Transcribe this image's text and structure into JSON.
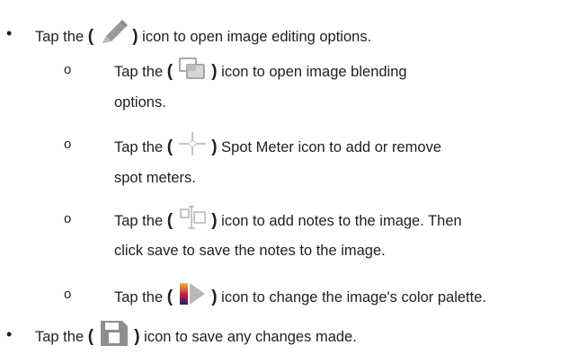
{
  "bullets": {
    "main_symbol": "•",
    "sub_symbol": "o"
  },
  "items": {
    "edit": {
      "prefix": "Tap the",
      "open_paren": "(",
      "close_paren": ")",
      "icon": "pencil-edit-icon",
      "suffix": "icon to open image editing options."
    },
    "blend": {
      "prefix": "Tap the",
      "open_paren": "(",
      "close_paren": ")",
      "icon": "image-blend-icon",
      "suffix": "icon to open image blending",
      "continuation": "options."
    },
    "spot": {
      "prefix": "Tap the",
      "open_paren": "(",
      "close_paren": ")",
      "icon": "spot-meter-crosshair-icon",
      "suffix": "Spot Meter icon to add or remove",
      "continuation": "spot meters."
    },
    "notes": {
      "prefix": "Tap the",
      "open_paren": "(",
      "close_paren": ")",
      "icon": "notes-annotation-icon",
      "suffix": "icon to add notes to the image. Then",
      "continuation": "click save to save the notes to the image."
    },
    "palette": {
      "prefix": "Tap the",
      "open_paren": "(",
      "close_paren": ")",
      "icon": "color-palette-icon",
      "suffix": "icon to change the image's color palette."
    },
    "save": {
      "prefix": "Tap the",
      "open_paren": "(",
      "close_paren": ")",
      "icon": "save-floppy-icon",
      "suffix": "icon to save any changes made."
    }
  },
  "colors": {
    "text": "#1f1f1f",
    "icon_gray": "#9a9a9a",
    "icon_light": "#b5b5b5",
    "palette_dark": "#2a1a6e",
    "palette_mid": "#c8214a",
    "palette_light": "#f5b431"
  }
}
